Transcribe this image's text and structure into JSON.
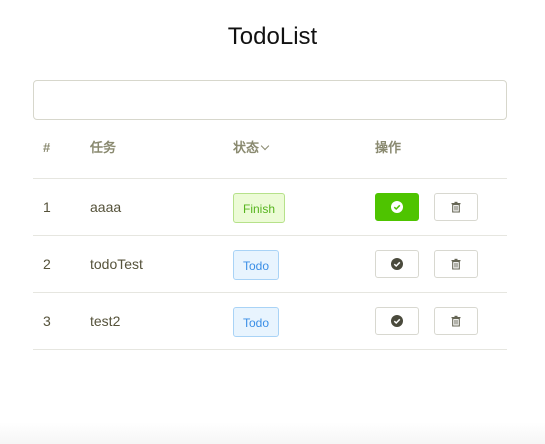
{
  "app": {
    "title": "TodoList"
  },
  "new_todo": {
    "value": "",
    "placeholder": ""
  },
  "table": {
    "headers": {
      "index": "#",
      "task": "任务",
      "status": "状态",
      "actions": "操作"
    },
    "rows": [
      {
        "index": "1",
        "task": "aaaa",
        "status": "Finish",
        "done": true
      },
      {
        "index": "2",
        "task": "todoTest",
        "status": "Todo",
        "done": false
      },
      {
        "index": "3",
        "task": "test2",
        "status": "Todo",
        "done": false
      }
    ]
  },
  "icons": {
    "complete": "check-circle-icon",
    "delete": "trash-icon",
    "sort": "chevron-down-icon"
  },
  "colors": {
    "finish_badge_text": "#56b41e",
    "todo_badge_text": "#3a8ee6",
    "done_button": "#4ec400"
  }
}
